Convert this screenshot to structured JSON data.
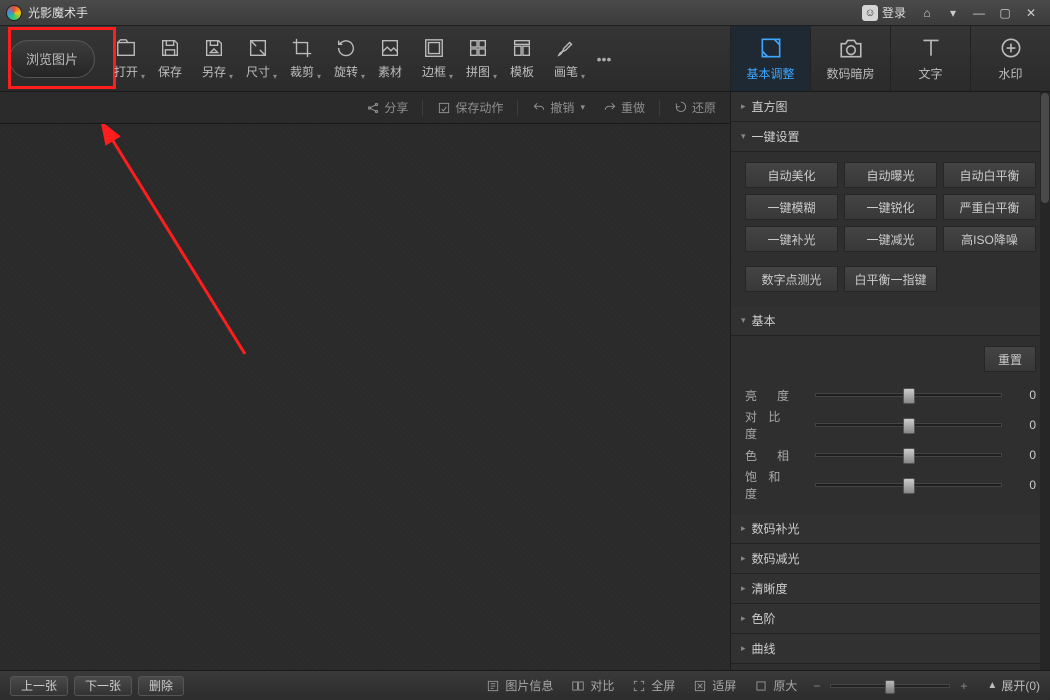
{
  "title": "光影魔术手",
  "login": "登录",
  "toolbar": {
    "browse": "浏览图片",
    "items": [
      "打开",
      "保存",
      "另存",
      "尺寸",
      "裁剪",
      "旋转",
      "素材",
      "边框",
      "拼图",
      "模板",
      "画笔"
    ],
    "more": "•••"
  },
  "tabs": [
    "基本调整",
    "数码暗房",
    "文字",
    "水印"
  ],
  "actionbar": {
    "share": "分享",
    "saveaction": "保存动作",
    "undo": "撤销",
    "redo": "重做",
    "restore": "还原"
  },
  "sections": {
    "histogram": "直方图",
    "oneclick": "一键设置",
    "basic": "基本",
    "digitfill": "数码补光",
    "digitcut": "数码减光",
    "clarity": "清晰度",
    "levels": "色阶",
    "curve": "曲线"
  },
  "oneclick_buttons": [
    "自动美化",
    "自动曝光",
    "自动白平衡",
    "一键模糊",
    "一键锐化",
    "严重白平衡",
    "一键补光",
    "一键减光",
    "高ISO降噪"
  ],
  "oneclick_buttons2": [
    "数字点测光",
    "白平衡一指键"
  ],
  "basic_panel": {
    "reset": "重置",
    "sliders": [
      {
        "label": "亮　度",
        "value": 0
      },
      {
        "label": "对 比 度",
        "value": 0
      },
      {
        "label": "色　相",
        "value": 0
      },
      {
        "label": "饱 和 度",
        "value": 0
      }
    ]
  },
  "bottom": {
    "prev": "上一张",
    "next": "下一张",
    "del": "删除",
    "info": "图片信息",
    "compare": "对比",
    "fullscreen": "全屏",
    "fit": "适屏",
    "orig": "原大",
    "expand": "展开(0)"
  }
}
